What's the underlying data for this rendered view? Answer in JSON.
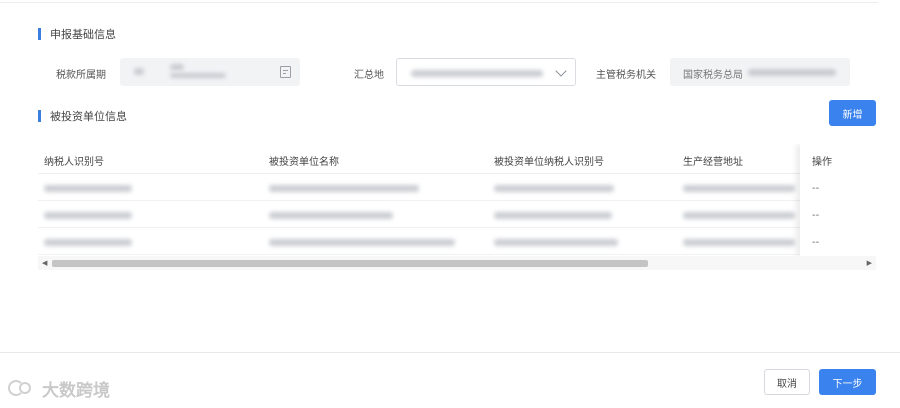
{
  "declaration_info": {
    "section_title": "申报基础信息",
    "tax_period_label": "税款所属期",
    "summary_location_label": "汇总地",
    "tax_authority_label": "主管税务机关",
    "tax_authority_value_prefix": "国家税务总局"
  },
  "invested_units": {
    "section_title": "被投资单位信息",
    "add_button": "新增",
    "columns": [
      "纳税人识别号",
      "被投资单位名称",
      "被投资单位纳税人识别号",
      "生产经营地址",
      "操作"
    ],
    "rows": [
      {
        "operation": "--"
      },
      {
        "operation": "--"
      },
      {
        "operation": "--"
      }
    ]
  },
  "footer": {
    "cancel_button": "取消",
    "next_button": "下一步",
    "logo_text": "大数跨境"
  },
  "colors": {
    "accent": "#3a82ee",
    "section_bar": "#3a7ee0"
  },
  "icons": [
    "calendar-icon",
    "chevron-down-icon",
    "scroll-left-icon",
    "scroll-right-icon",
    "logo-icon"
  ]
}
